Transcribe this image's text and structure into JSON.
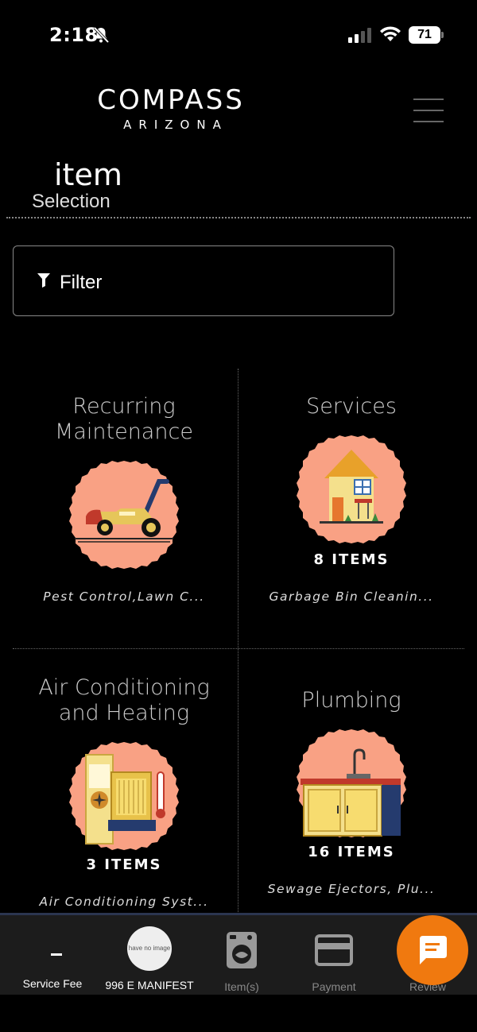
{
  "status_bar": {
    "time": "2:18",
    "battery_level": "71",
    "icons": [
      "bell-slash-icon",
      "cellular-signal-icon",
      "wifi-icon",
      "battery-icon"
    ]
  },
  "header": {
    "logo_main": "COMPASS",
    "logo_sub": "ARIZONA",
    "menu_icon": "hamburger-menu-icon"
  },
  "page": {
    "title": "item",
    "subtitle": "Selection"
  },
  "filter": {
    "label": "Filter",
    "icon": "funnel-icon"
  },
  "categories": [
    {
      "title": "Recurring\nMaintenance",
      "count": "",
      "description": "Pest Control,Lawn C...",
      "icon": "lawn-mower-icon"
    },
    {
      "title": "Services",
      "count": "8 ITEMS",
      "description": "Garbage Bin Cleanin...",
      "icon": "house-icon"
    },
    {
      "title": "Air Conditioning\nand Heating",
      "count": "3 ITEMS",
      "description": "Air Conditioning Syst...",
      "icon": "air-conditioner-icon"
    },
    {
      "title": "Plumbing",
      "count": "16 ITEMS",
      "description": "Sewage Ejectors, Plu...",
      "icon": "sink-cabinet-icon"
    }
  ],
  "bottom_nav": {
    "items": [
      {
        "label": "Service Fee",
        "value": "-"
      },
      {
        "label": "996 E MANIFEST",
        "avatar_text": "have no image"
      },
      {
        "label": "Item(s)",
        "icon": "washing-machine-icon"
      },
      {
        "label": "Payment",
        "icon": "credit-card-icon"
      },
      {
        "label": "Review"
      }
    ],
    "chat_icon": "chat-bubble-icon"
  },
  "colors": {
    "background": "#000000",
    "badge": "#f9a184",
    "chat_button": "#f0790f",
    "nav_background": "#1c1c1c"
  }
}
